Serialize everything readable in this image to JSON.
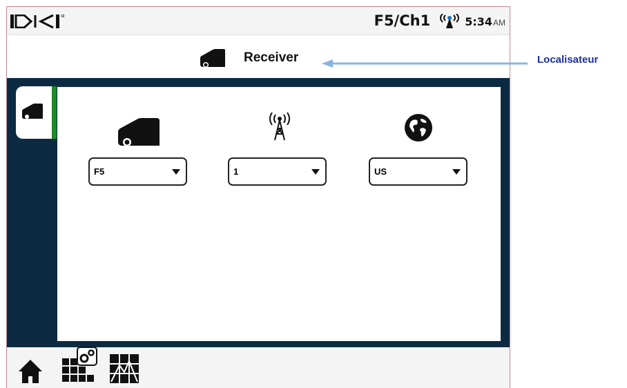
{
  "status_bar": {
    "logo_icon": "dci-logo",
    "freq_channel": "F5/Ch1",
    "signal_icon": "antenna-signal-icon",
    "time": "5:34",
    "ampm": "AM"
  },
  "header": {
    "icon": "receiver-icon",
    "title": "Receiver"
  },
  "sidebar": {
    "tabs": [
      {
        "icon": "receiver-icon",
        "selected": true
      }
    ]
  },
  "panel": {
    "columns": [
      {
        "icon": "receiver-icon",
        "value": "F5"
      },
      {
        "icon": "antenna-tower-icon",
        "value": "1"
      },
      {
        "icon": "globe-icon",
        "value": "US"
      }
    ]
  },
  "bottom_bar": {
    "items": [
      {
        "icon": "home-icon"
      },
      {
        "icon": "settings-grid-icon"
      },
      {
        "icon": "grid-map-icon"
      }
    ]
  },
  "callout": {
    "label": "Localisateur",
    "color": "#1c2fa0",
    "arrow_color": "#8bb3e0"
  },
  "colors": {
    "main_bg": "#0c2b42",
    "selected_tab_bar": "#1e8a26"
  }
}
